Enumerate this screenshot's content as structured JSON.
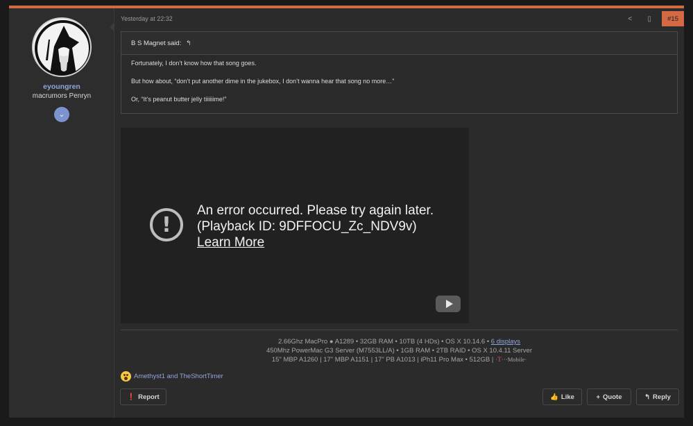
{
  "post": {
    "timestamp": "Yesterday at 22:32",
    "number": "#15",
    "tools": {
      "share_icon": "share-icon",
      "bookmark_icon": "bookmark-icon"
    }
  },
  "author": {
    "username": "eyoungren",
    "title": "macrumors Penryn",
    "avatar_icon": "wizard-avatar",
    "expand_icon": "chevron-down-icon"
  },
  "quote": {
    "header": "B S Magnet said:",
    "lines": [
      "Fortunately, I don’t know how that song goes.",
      "But how about, “don’t put another dime in the jukebox, I don’t wanna hear that song no more…”",
      "Or, “It’s peanut butter jelly tiiiiiime!”"
    ]
  },
  "video": {
    "error_line1": "An error occurred. Please try again later.",
    "error_line2": "(Playback ID: 9DFFOCU_Zc_NDV9v)",
    "learn_more": "Learn More"
  },
  "signature": {
    "line1_prefix": "2.66Ghz MacPro",
    "line1_model": "A1289 • 32GB RAM • 10TB (4 HDs) • OS X 10.14.6 •",
    "line1_link": "6 displays",
    "line2": "450Mhz PowerMac G3 Server (M7553LL/A) • 1GB RAM • 2TB RAID • OS X 10.4.11 Server",
    "line3": "15\" MBP A1260 | 17\" MBP A1151 | 17\" PB A1013 | iPh11 Pro Max • 512GB |",
    "carrier_t": "·T·",
    "carrier_rest": "··Mobile·"
  },
  "reactions": {
    "text": "Amethyst1 and TheShortTimer"
  },
  "actions": {
    "report": "Report",
    "like": "Like",
    "quote": "Quote",
    "reply": "Reply"
  },
  "colors": {
    "accent": "#d36a44",
    "link": "#8fa7dd"
  }
}
